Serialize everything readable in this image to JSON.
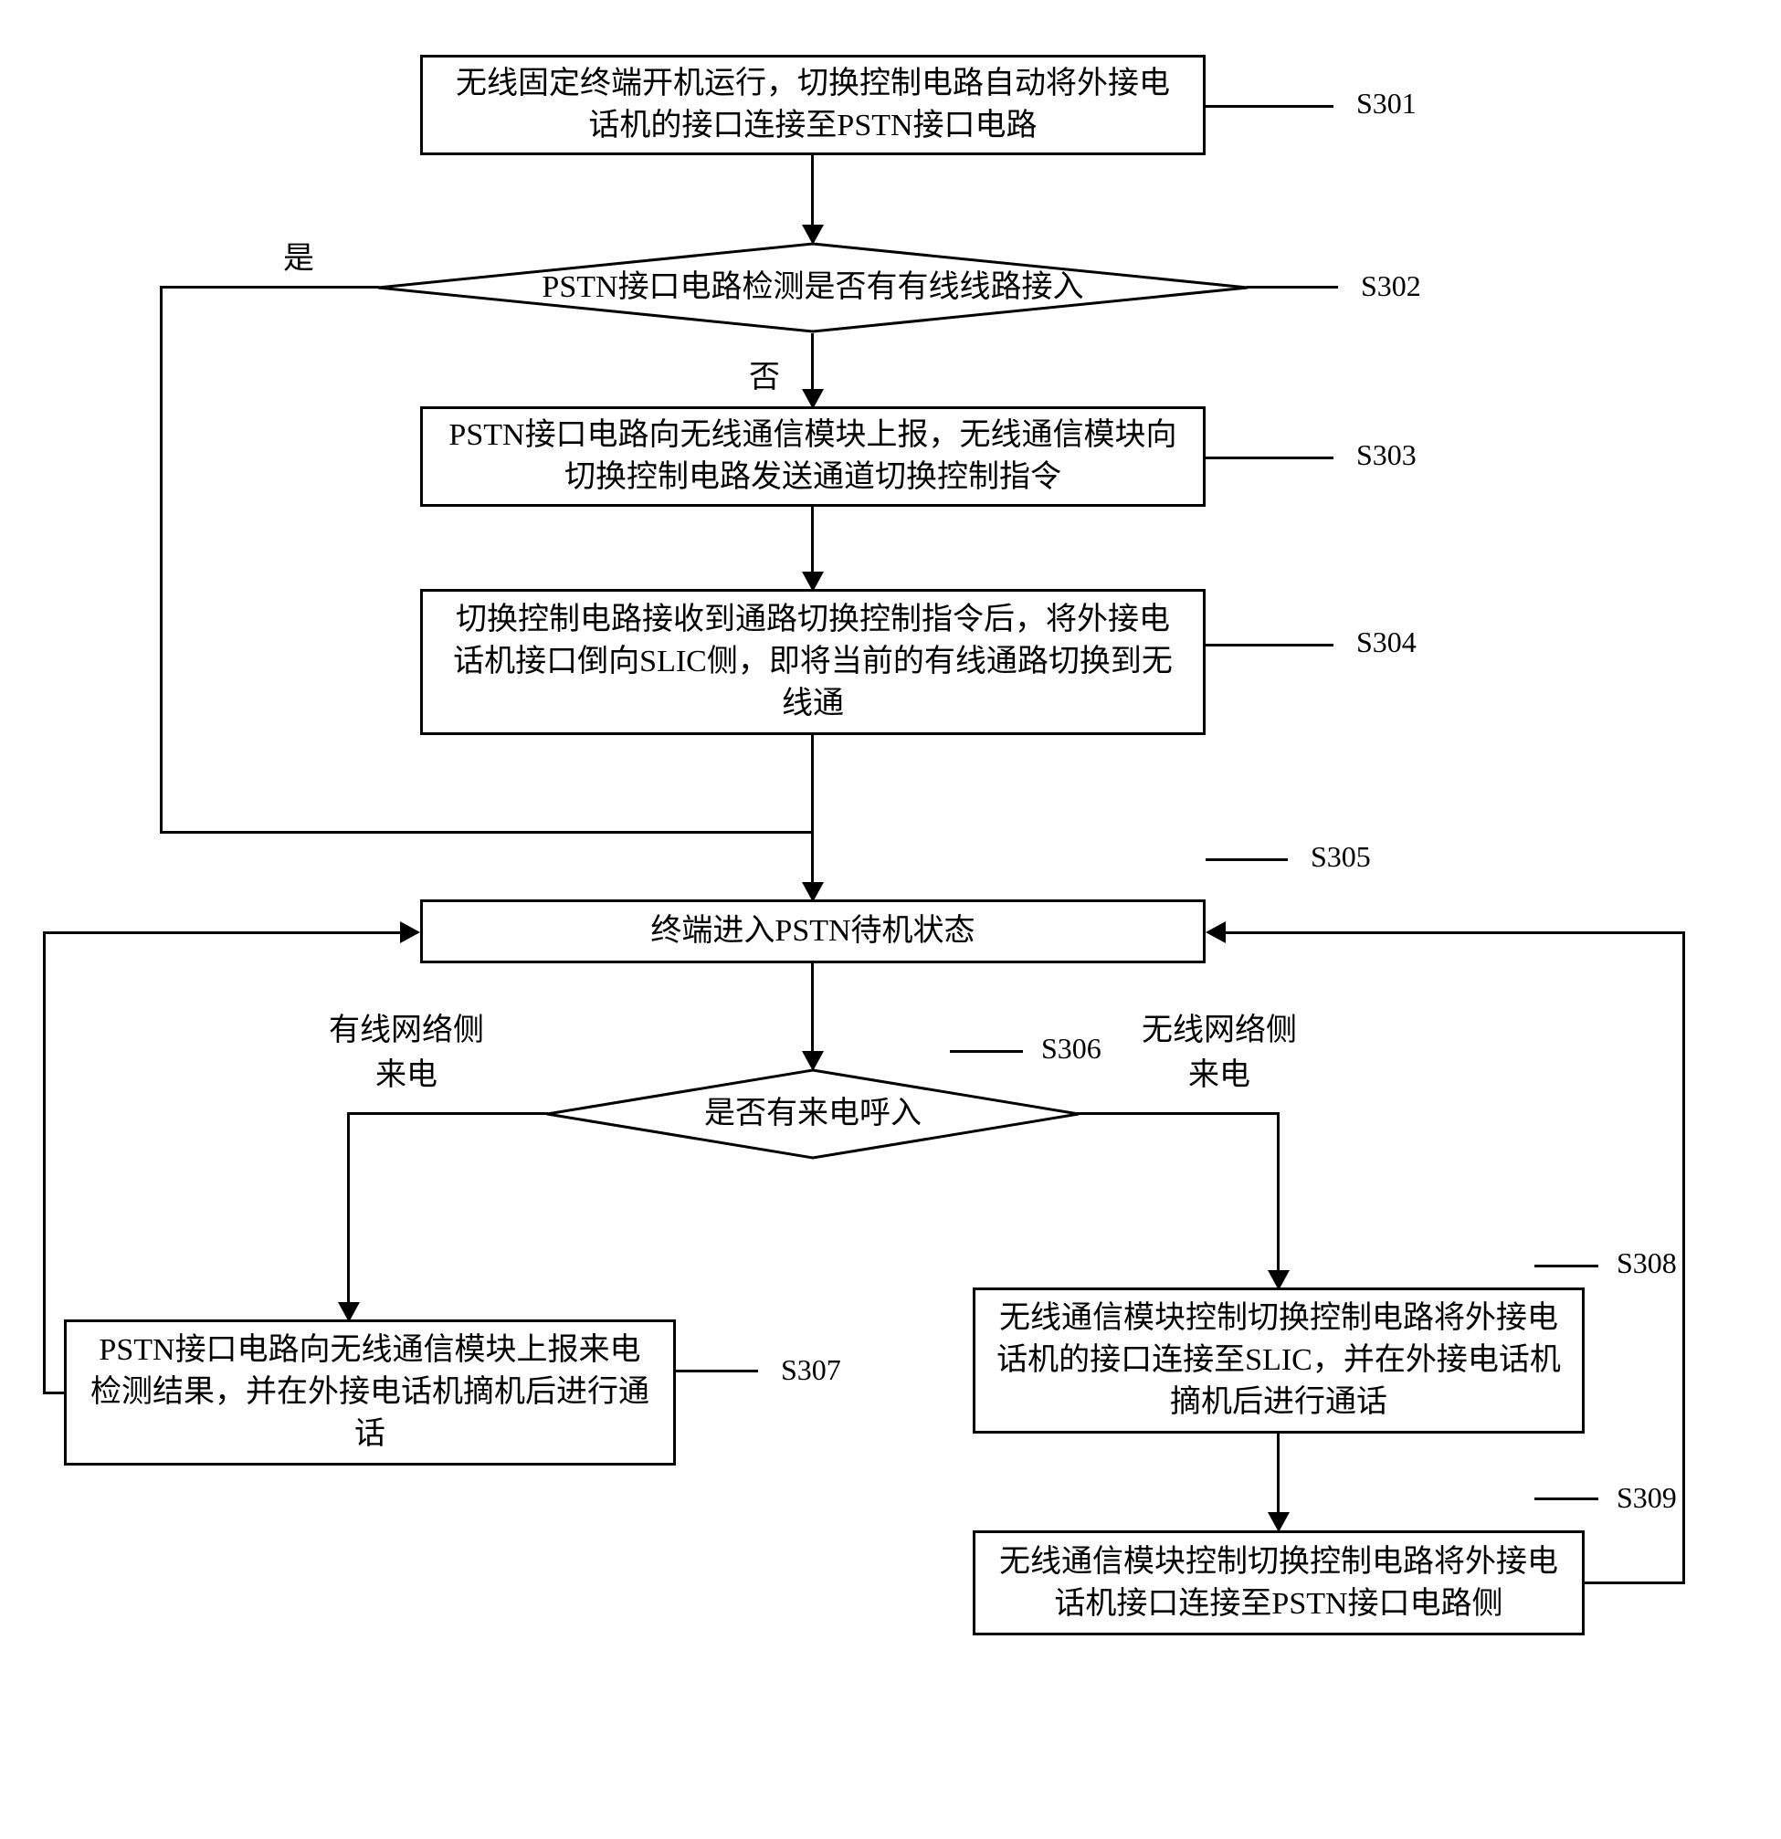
{
  "steps": {
    "s301": {
      "id": "S301",
      "text": "无线固定终端开机运行，切换控制电路自动将外接电话机的接口连接至PSTN接口电路"
    },
    "s302": {
      "id": "S302",
      "text": "PSTN接口电路检测是否有有线线路接入"
    },
    "s303": {
      "id": "S303",
      "text": "PSTN接口电路向无线通信模块上报，无线通信模块向切换控制电路发送通道切换控制指令"
    },
    "s304": {
      "id": "S304",
      "text": "切换控制电路接收到通路切换控制指令后，将外接电话机接口倒向SLIC侧，即将当前的有线通路切换到无线通"
    },
    "s305": {
      "id": "S305",
      "text": "终端进入PSTN待机状态"
    },
    "s306": {
      "id": "S306",
      "text": "是否有来电呼入"
    },
    "s307": {
      "id": "S307",
      "text": "PSTN接口电路向无线通信模块上报来电检测结果，并在外接电话机摘机后进行通话"
    },
    "s308": {
      "id": "S308",
      "text": "无线通信模块控制切换控制电路将外接电话机的接口连接至SLIC，并在外接电话机摘机后进行通话"
    },
    "s309": {
      "id": "S309",
      "text": "无线通信模块控制切换控制电路将外接电话机接口连接至PSTN接口电路侧"
    }
  },
  "branches": {
    "yes": "是",
    "no": "否",
    "wired_side": "有线网络侧来电",
    "wireless_side": "无线网络侧来电"
  }
}
